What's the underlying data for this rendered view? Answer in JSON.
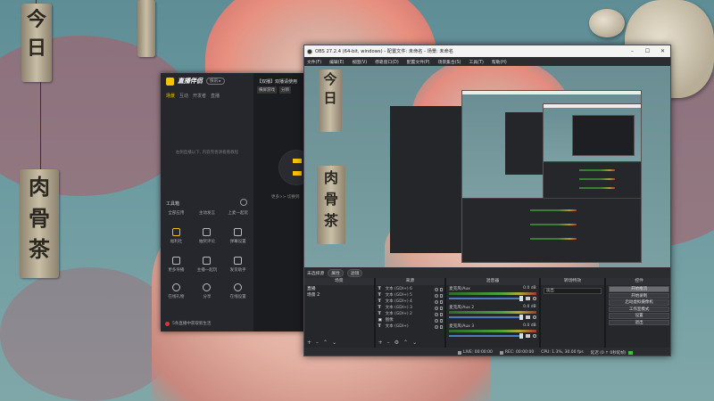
{
  "wallpaper": {
    "plank_left_top": [
      "今",
      "日"
    ],
    "plank_left_bottom": [
      "肉",
      "骨",
      "茶"
    ]
  },
  "companion_app": {
    "title": "直播伴侣",
    "tag": "快讯 ▸",
    "tabs": [
      "场景",
      "互动",
      "开发者",
      "直播"
    ],
    "empty_message": "右侧直播以下, 内容完善请看看教程",
    "tools_label": "工具箱",
    "tool_rows": [
      [
        "全部应用",
        "主动发言",
        "上麦一起玩"
      ],
      [
        "福利社",
        "抽奖评论",
        "弹幕设置"
      ],
      [
        "更多导播",
        "主播一起玩",
        "发货助手"
      ],
      [
        "在线礼物",
        "分享",
        "在线设置"
      ]
    ],
    "footer": "5条直播中获取新生活",
    "right_title": "【双播】双播请使用",
    "right_chips": [
      "横屏游戏",
      "分辨"
    ],
    "right_more": "更多>> 切换到"
  },
  "obs": {
    "title": "OBS 27.2.4 (64-bit, windows) - 配置文件: 未命名 - 场景: 未命名",
    "menu": [
      "文件(F)",
      "编辑(E)",
      "视图(V)",
      "停靠窗口(D)",
      "配置文件(P)",
      "场景集合(S)",
      "工具(T)",
      "帮助(H)"
    ],
    "dockbar_label": "未选择源",
    "dockbar_buttons": [
      "属性",
      "滤镜"
    ],
    "docks": {
      "scenes_title": "场景",
      "scenes": [
        "直播",
        "场景 2"
      ],
      "sources_title": "来源",
      "sources": [
        "文本 (GDI+) 6",
        "文本 (GDI+) 5",
        "文本 (GDI+) 4",
        "文本 (GDI+) 3",
        "文本 (GDI+) 2",
        "图像",
        "文本 (GDI+)"
      ],
      "mixer_title": "混音器",
      "mixer": [
        {
          "name": "麦克风/Aux",
          "db": "0.0 dB"
        },
        {
          "name": "麦克风/Aux 2",
          "db": "0.0 dB"
        },
        {
          "name": "麦克风/Aux 3",
          "db": "0.0 dB"
        }
      ],
      "transitions_title": "转场特效",
      "transition_value": "淡出",
      "controls_title": "控件",
      "controls": [
        "开始推流",
        "开始录制",
        "启动虚拟摄像机",
        "工作室模式",
        "设置",
        "退出"
      ]
    },
    "status": {
      "live": "LIVE: 00:00:00",
      "rec": "REC: 00:00:00",
      "cpu": "CPU: 1.3%, 30.00 fps",
      "bitrate": "延迟 (0 ↑ 0秒延帧)"
    }
  }
}
